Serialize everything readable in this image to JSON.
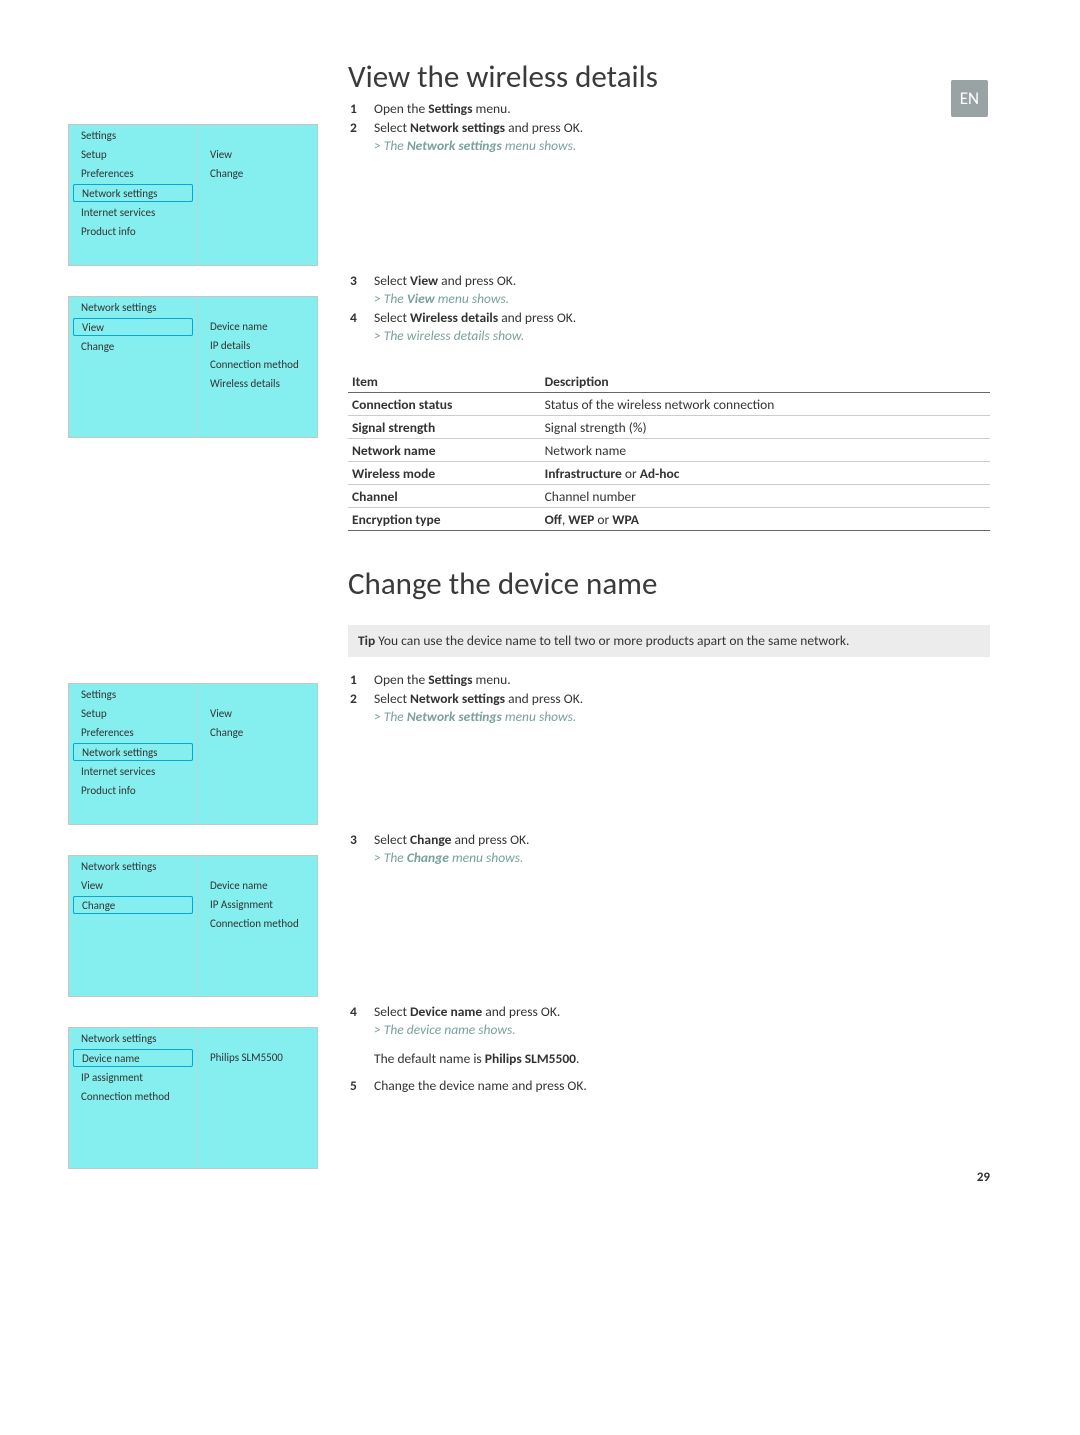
{
  "lang": "EN",
  "page_number": "29",
  "section1": {
    "title": "View the wireless details",
    "steps_a": {
      "1": {
        "pre": "Open the ",
        "bold": "Settings",
        "post": " menu."
      },
      "2": {
        "pre": "Select ",
        "bold": "Network settings",
        "post": " and press OK.",
        "result_pre": "The ",
        "result_bold": "Network settings",
        "result_post": " menu shows."
      }
    },
    "steps_b": {
      "3": {
        "pre": "Select ",
        "bold": "View",
        "post": " and press OK.",
        "result_pre": "The ",
        "result_bold": "View",
        "result_post": " menu shows."
      },
      "4": {
        "pre": "Select ",
        "bold": "Wireless details",
        "post": " and press OK.",
        "result": "The wireless details show."
      }
    },
    "menu1": {
      "title": "Settings",
      "left": [
        "Setup",
        "Preferences",
        "Network settings",
        "Internet services",
        "Product info"
      ],
      "selected": "Network settings",
      "right": [
        "View",
        "Change"
      ]
    },
    "menu2": {
      "title": "Network settings",
      "left": [
        "View",
        "Change"
      ],
      "selected": "View",
      "right": [
        "Device name",
        "IP details",
        "Connection method",
        "Wireless details"
      ]
    },
    "table": {
      "h1": "Item",
      "h2": "Description",
      "rows": [
        {
          "c1": "Connection status",
          "c2": "Status of the wireless network connection",
          "bold": []
        },
        {
          "c1": "Signal strength",
          "c2": "Signal strength (%)",
          "bold": []
        },
        {
          "c1": "Network name",
          "c2": "Network name",
          "bold": []
        },
        {
          "c1": "Wireless mode",
          "c2_b1": "Infrastructure",
          "c2_mid": " or ",
          "c2_b2": "Ad-hoc"
        },
        {
          "c1": "Channel",
          "c2": "Channel number",
          "bold": []
        },
        {
          "c1": "Encryption type",
          "c2_b1": "Off",
          "c2_mid1": ", ",
          "c2_b2": "WEP",
          "c2_mid2": " or ",
          "c2_b3": "WPA"
        }
      ]
    }
  },
  "section2": {
    "title": "Change the device name",
    "tip_label": "Tip",
    "tip_text": " You can use the device name to tell two or more products apart on the same network.",
    "steps_a": {
      "1": {
        "pre": "Open the ",
        "bold": "Settings",
        "post": " menu."
      },
      "2": {
        "pre": "Select ",
        "bold": "Network settings",
        "post": " and press OK.",
        "result_pre": "The ",
        "result_bold": "Network settings",
        "result_post": " menu shows."
      }
    },
    "steps_b": {
      "3": {
        "pre": "Select ",
        "bold": "Change",
        "post": " and press OK.",
        "result_pre": "The ",
        "result_bold": "Change",
        "result_post": " menu shows."
      }
    },
    "steps_c": {
      "4": {
        "pre": "Select ",
        "bold": "Device name",
        "post": " and press OK.",
        "result": "The device name shows."
      },
      "note_pre": "The default name is ",
      "note_bold": "Philips SLM5500",
      "note_post": ".",
      "5": {
        "text": "Change the device name and press OK."
      }
    },
    "menu1": {
      "title": "Settings",
      "left": [
        "Setup",
        "Preferences",
        "Network settings",
        "Internet services",
        "Product info"
      ],
      "selected": "Network settings",
      "right": [
        "View",
        "Change"
      ]
    },
    "menu2": {
      "title": "Network settings",
      "left": [
        "View",
        "Change"
      ],
      "selected": "Change",
      "right": [
        "Device name",
        "IP Assignment",
        "Connection method"
      ]
    },
    "menu3": {
      "title": "Network settings",
      "left": [
        "Device name",
        "IP assignment",
        "Connection method"
      ],
      "selected": "Device name",
      "right": [
        "Philips SLM5500"
      ]
    }
  }
}
